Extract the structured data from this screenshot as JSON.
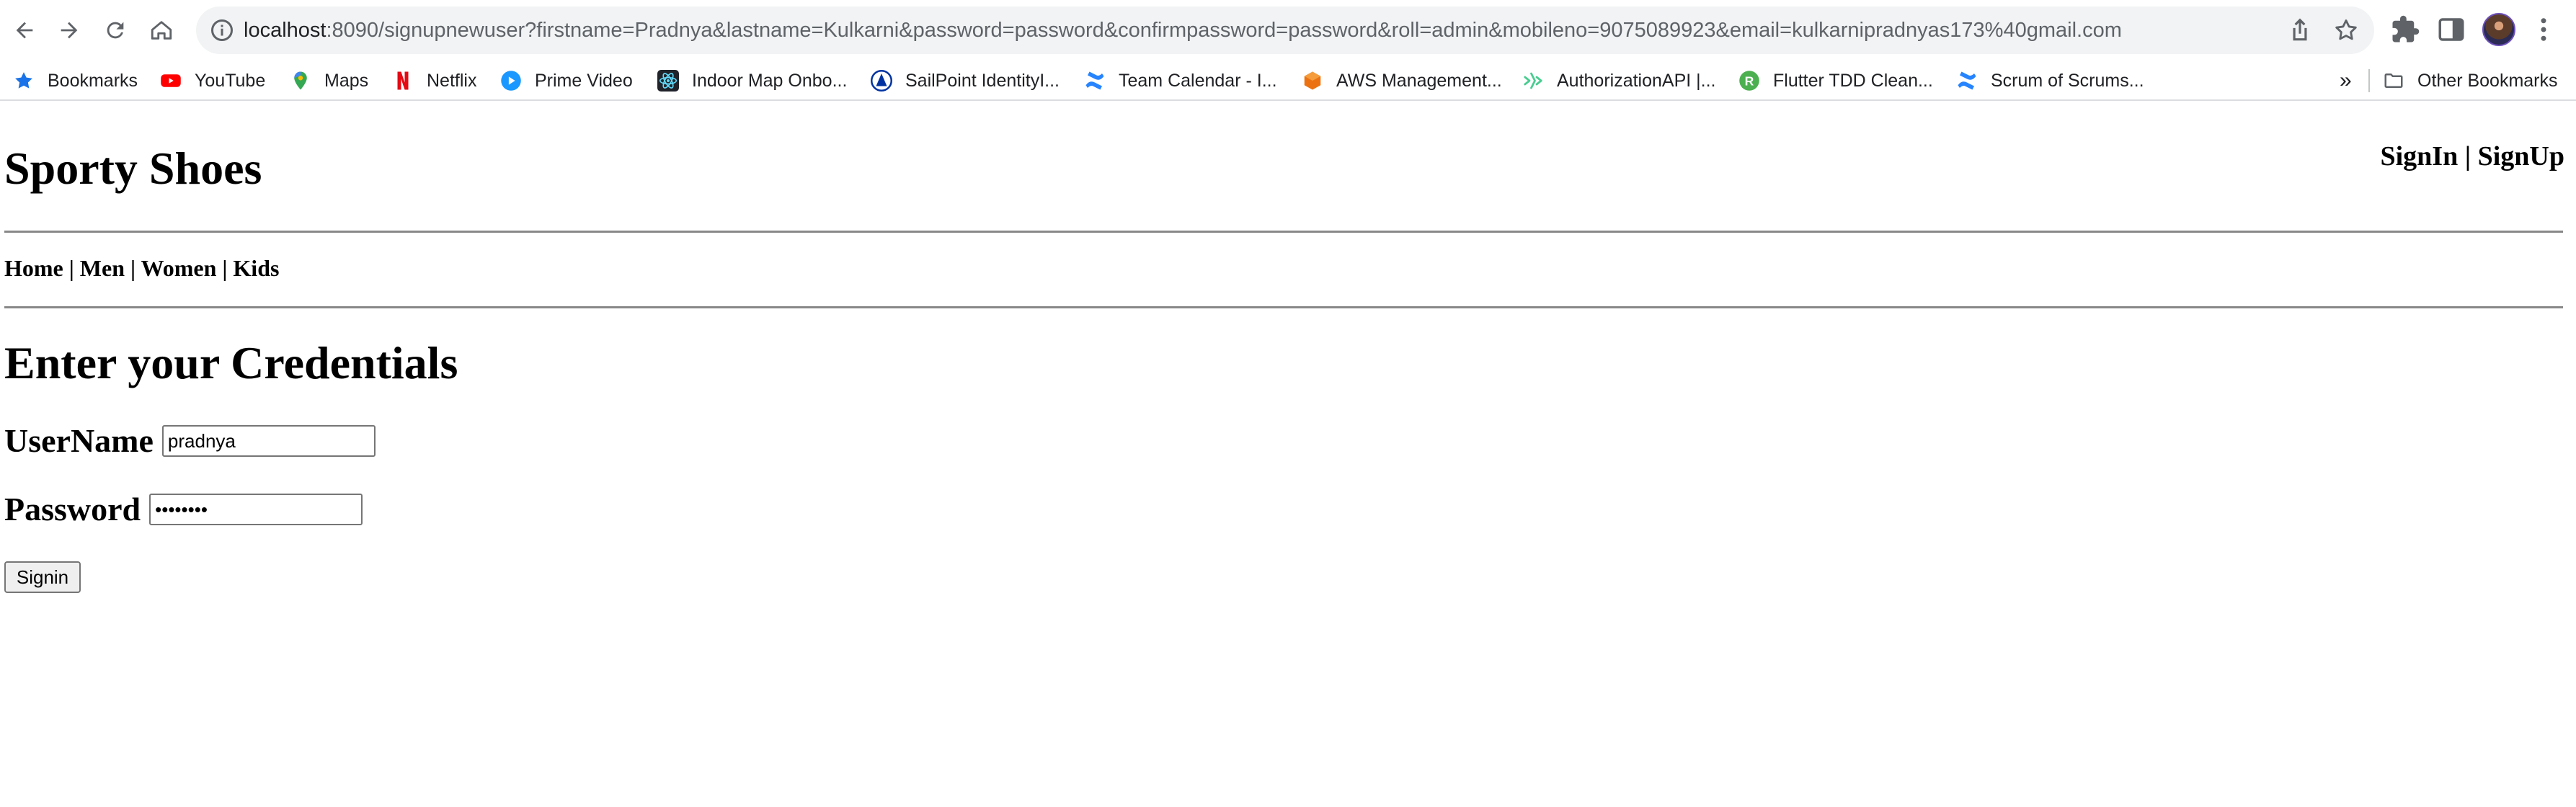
{
  "browser": {
    "url_host": "localhost",
    "url_rest": ":8090/signupnewuser?firstname=Pradnya&lastname=Kulkarni&password=password&confirmpassword=password&roll=admin&mobileno=9075089923&email=kulkarnipradnyas173%40gmail.com",
    "nav_icons": [
      "back-arrow-icon",
      "forward-arrow-icon",
      "reload-icon",
      "home-icon"
    ],
    "omnibox_icons": [
      "info-icon",
      "share-icon",
      "star-icon"
    ],
    "right_icons": [
      "extensions-puzzle-icon",
      "side-panel-icon",
      "profile-avatar",
      "more-vertical-icon"
    ]
  },
  "bookmarks": {
    "items": [
      {
        "label": "Bookmarks",
        "icon": "star-icon",
        "color": "#1a73e8"
      },
      {
        "label": "YouTube",
        "icon": "youtube-icon",
        "color": "#ff0000"
      },
      {
        "label": "Maps",
        "icon": "maps-pin-icon",
        "color": "#34a853"
      },
      {
        "label": "Netflix",
        "icon": "netflix-icon",
        "color": "#e50914"
      },
      {
        "label": "Prime Video",
        "icon": "prime-video-icon",
        "color": "#1a98ff"
      },
      {
        "label": "Indoor Map Onbo...",
        "icon": "react-icon",
        "color": "#61dafb"
      },
      {
        "label": "SailPoint IdentityI...",
        "icon": "sailpoint-icon",
        "color": "#0033a1"
      },
      {
        "label": "Team Calendar - I...",
        "icon": "confluence-icon",
        "color": "#2684ff"
      },
      {
        "label": "AWS Management...",
        "icon": "aws-icon",
        "color": "#ec7211"
      },
      {
        "label": "AuthorizationAPI |...",
        "icon": "swagger-icon",
        "color": "#49cc90"
      },
      {
        "label": "Flutter TDD Clean...",
        "icon": "r-icon",
        "color": "#4caf50"
      },
      {
        "label": "Scrum of Scrums...",
        "icon": "confluence-icon",
        "color": "#2684ff"
      }
    ],
    "overflow_label": "»",
    "other_label": "Other Bookmarks"
  },
  "page": {
    "site_title": "Sporty Shoes",
    "auth": {
      "signin": "SignIn",
      "separator": " | ",
      "signup": "SignUp"
    },
    "nav": {
      "home": "Home",
      "men": "Men",
      "women": "Women",
      "kids": "Kids",
      "separator": " | "
    },
    "heading": "Enter your Credentials",
    "form": {
      "username_label": "UserName",
      "username_value": "pradnya",
      "password_label": "Password",
      "password_value": "password",
      "submit_label": "Signin"
    }
  }
}
